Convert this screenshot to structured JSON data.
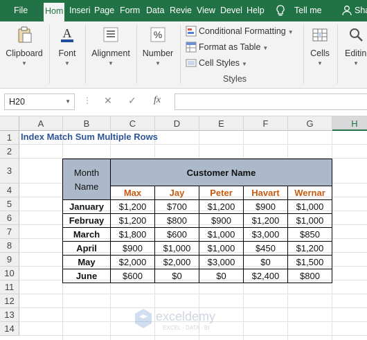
{
  "tabs": {
    "file": "File",
    "home": "Hom",
    "insert": "Inseri",
    "page": "Page",
    "form": "Form",
    "data": "Data",
    "review": "Revie",
    "view": "View",
    "developer": "Devel",
    "help": "Help",
    "tell_me": "Tell me",
    "share": "Sha"
  },
  "ribbon": {
    "clipboard": "Clipboard",
    "font": "Font",
    "alignment": "Alignment",
    "number": "Number",
    "number_symbol": "%",
    "font_symbol": "A",
    "conditional_formatting": "Conditional Formatting",
    "format_as_table": "Format as Table",
    "cell_styles": "Cell Styles",
    "styles_group": "Styles",
    "cells": "Cells",
    "editing": "Editin"
  },
  "formula_bar": {
    "name_box": "H20",
    "fx_label": "fx",
    "formula": ""
  },
  "grid": {
    "columns": [
      "A",
      "B",
      "C",
      "D",
      "E",
      "F",
      "G",
      "H"
    ],
    "rows": [
      "1",
      "2",
      "3",
      "4",
      "5",
      "6",
      "7",
      "8",
      "9",
      "10",
      "11",
      "12",
      "13",
      "14"
    ],
    "selected_column": "H"
  },
  "sheet": {
    "title": "Index Match Sum Multiple Rows",
    "month_header": "Month Name",
    "customer_header": "Customer Name",
    "customers": [
      "Max",
      "Jay",
      "Peter",
      "Havart",
      "Wernar"
    ],
    "table": [
      {
        "month": "January",
        "values": [
          "$1,200",
          "$700",
          "$1,200",
          "$900",
          "$1,000"
        ]
      },
      {
        "month": "Februay",
        "values": [
          "$1,200",
          "$800",
          "$900",
          "$1,200",
          "$1,000"
        ]
      },
      {
        "month": "March",
        "values": [
          "$1,800",
          "$600",
          "$1,000",
          "$3,000",
          "$850"
        ]
      },
      {
        "month": "April",
        "values": [
          "$900",
          "$1,000",
          "$1,000",
          "$450",
          "$1,200"
        ]
      },
      {
        "month": "May",
        "values": [
          "$2,000",
          "$2,000",
          "$3,000",
          "$0",
          "$1,500"
        ]
      },
      {
        "month": "June",
        "values": [
          "$600",
          "$0",
          "$0",
          "$2,400",
          "$800"
        ]
      }
    ]
  },
  "watermark": {
    "name": "exceldemy",
    "tagline": "EXCEL · DATA · BI"
  },
  "colors": {
    "ribbon_green": "#217346",
    "title_blue": "#2e5597",
    "header_fill": "#acb9ca",
    "customer_orange": "#c55a11"
  }
}
